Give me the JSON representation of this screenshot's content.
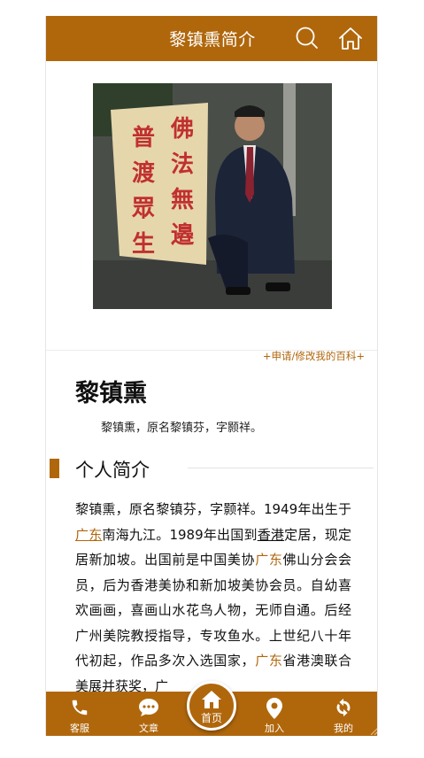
{
  "header": {
    "title": "黎镇熏简介",
    "search_icon": "search-icon",
    "home_icon": "home-icon"
  },
  "photo": {
    "rock_text_col1": "佛法無邉",
    "rock_text_col2": "普渡眾生"
  },
  "edit_link": "+申请/修改我的百科+",
  "profile": {
    "name": "黎镇熏",
    "summary": "黎镇熏，原名黎镇芬，字颢祥。"
  },
  "section": {
    "title": "个人简介"
  },
  "body": {
    "p1": "黎镇熏，原名黎镇芬，字颢祥。1949年出生于",
    "link1": "广东",
    "p2": "南海九江。1989年出国到",
    "link2": "香港",
    "p3": "定居，现定居新加坡。出国前是中国美协",
    "hl1": "广东",
    "p4": "佛山分会会员，后为香港美协和新加坡美协会员。自幼喜欢画画，喜画山水花鸟人物，无师自通。后经广州美院教授指导，专攻鱼水。上世纪八十年代初起，作品多次入选国家，",
    "hl2": "广东",
    "p5": "省港澳联合美展并获奖，广"
  },
  "bottom_nav": {
    "items": [
      {
        "label": "客服",
        "icon": "phone-icon"
      },
      {
        "label": "文章",
        "icon": "chat-icon"
      },
      {
        "label": "首页",
        "icon": "home-icon"
      },
      {
        "label": "加入",
        "icon": "location-pin-icon"
      },
      {
        "label": "我的",
        "icon": "refresh-icon"
      }
    ]
  },
  "colors": {
    "brand": "#b0670c",
    "background": "#ffffff"
  }
}
